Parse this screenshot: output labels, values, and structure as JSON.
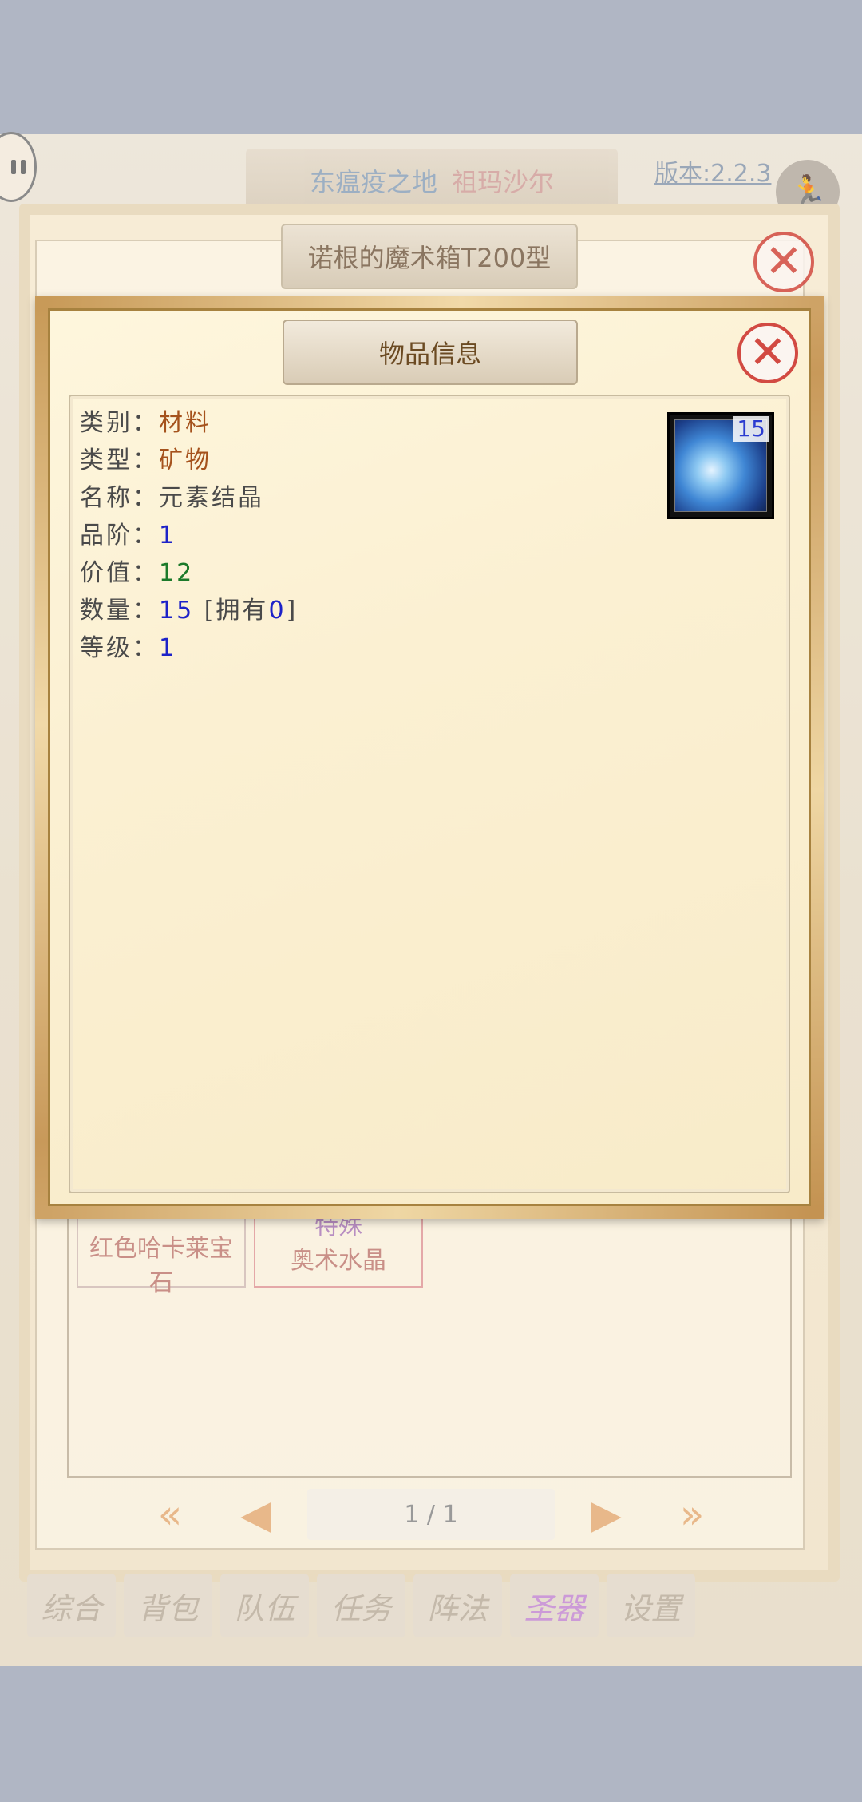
{
  "hud": {
    "zone": "东瘟疫之地",
    "npc": "祖玛沙尔",
    "version": "版本:2.2.3"
  },
  "panel": {
    "title": "诺根的魔术箱T200型",
    "items": [
      {
        "name": "红色哈卡莱宝石"
      },
      {
        "tag": "特殊",
        "name": "奥术水晶"
      }
    ],
    "pager": {
      "text": "1 / 1"
    }
  },
  "tabs": [
    "综合",
    "背包",
    "队伍",
    "任务",
    "阵法",
    "圣器",
    "设置"
  ],
  "active_tab": "圣器",
  "dialog": {
    "title": "物品信息",
    "rows": [
      {
        "label": "类别：",
        "value": "材料"
      },
      {
        "label": "类型：",
        "value": "矿物"
      },
      {
        "label": "名称：",
        "value": "元素结晶"
      },
      {
        "label": "品阶：",
        "value": "1"
      },
      {
        "label": "价值：",
        "value": "12"
      },
      {
        "label": "数量：",
        "value": "15",
        "extra_prefix": " [拥有",
        "owned": "0",
        "extra_suffix": "]"
      },
      {
        "label": "等级：",
        "value": "1"
      }
    ],
    "icon": {
      "name": "element-crystal-icon",
      "qty": "15"
    }
  }
}
